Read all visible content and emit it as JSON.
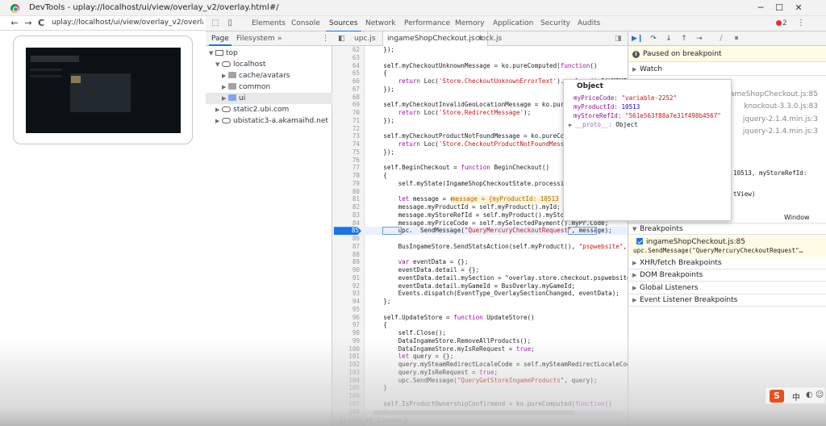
{
  "window": {
    "title": "DevTools - uplay://localhost/ui/view/overlay_v2/overlay.html#/",
    "controls": {
      "minimize": "─",
      "maximize": "☐",
      "close": "✕"
    }
  },
  "browser": {
    "back": "←",
    "forward": "→",
    "reload": "C",
    "url": "uplay://localhost/ui/view/overlay_v2/overlay.html#"
  },
  "devtools": {
    "tabs": [
      "Elements",
      "Console",
      "Sources",
      "Network",
      "Performance",
      "Memory",
      "Application",
      "Security",
      "Audits"
    ],
    "active_tab": "Sources",
    "error_count": "2",
    "accent": "#1a73e8"
  },
  "navigator": {
    "tabs": [
      "Page",
      "Filesystem"
    ],
    "more": "»",
    "tree": [
      {
        "label": "top",
        "icon": "frame-icon"
      },
      {
        "label": "localhost",
        "icon": "cloud-icon"
      },
      {
        "label": "cache/avatars",
        "icon": "folder-icon"
      },
      {
        "label": "common",
        "icon": "folder-icon"
      },
      {
        "label": "ui",
        "icon": "folder-icon"
      },
      {
        "label": "static2.ubi.com",
        "icon": "cloud-icon"
      },
      {
        "label": "ubistatic3-a.akamaihd.net",
        "icon": "cloud-icon"
      }
    ]
  },
  "editor": {
    "tabs": [
      "upc.js",
      "ingameShopCheckout.js",
      "clock.js"
    ],
    "active_tab": "ingameShopCheckout.js",
    "close_glyph": "×",
    "paused_line": "85",
    "inline_value": "message = {myProductId: 10513",
    "lines": [
      {
        "n": "62",
        "t": "    });"
      },
      {
        "n": "63",
        "t": ""
      },
      {
        "n": "64",
        "t": "    self.myCheckoutUnknownMessage = ko.pureComputed(function()"
      },
      {
        "n": "65",
        "t": "    {"
      },
      {
        "n": "66",
        "t": "        return Loc('Store.CheckoutUnknownErrorText').replace('_PAYMENT"
      },
      {
        "n": "67",
        "t": "    });"
      },
      {
        "n": "68",
        "t": ""
      },
      {
        "n": "69",
        "t": "    self.myCheckoutInvalidGeoLocationMessage = ko.pureCom"
      },
      {
        "n": "70",
        "t": "        return Loc('Store.RedirectMessage');"
      },
      {
        "n": "71",
        "t": "    });"
      },
      {
        "n": "72",
        "t": ""
      },
      {
        "n": "73",
        "t": "    self.myCheckoutProductNotFoundMessage = ko.pureComput"
      },
      {
        "n": "74",
        "t": "        return Loc('Store.CheckoutProductNotFoundMessage'"
      },
      {
        "n": "75",
        "t": "    });"
      },
      {
        "n": "76",
        "t": ""
      },
      {
        "n": "77",
        "t": "    self.BeginCheckout = function BeginCheckout()"
      },
      {
        "n": "78",
        "t": "    {"
      },
      {
        "n": "79",
        "t": "        self.myState(IngameShopCheckoutState.processing);"
      },
      {
        "n": "80",
        "t": ""
      },
      {
        "n": "81",
        "t": "        let message = {};"
      },
      {
        "n": "82",
        "t": "        message.myProductId = self.myProduct().myId;"
      },
      {
        "n": "83",
        "t": "        message.myStoreRefId = self.myProduct().myStoreRe"
      },
      {
        "n": "84",
        "t": "        message.myPriceCode = self.mySelectedPayment().myPr.Code;"
      },
      {
        "n": "85",
        "t": "        upc.  SendMessage(\"QueryMercuryCheckoutRequest\", message);"
      },
      {
        "n": "86",
        "t": ""
      },
      {
        "n": "87",
        "t": "        BusIngameStore.SendStatsAction(self.myProduct(), \"pspwebsite\","
      },
      {
        "n": "88",
        "t": ""
      },
      {
        "n": "89",
        "t": "        var eventData = {};"
      },
      {
        "n": "90",
        "t": "        eventData.detail = {};"
      },
      {
        "n": "91",
        "t": "        eventData.detail.mySection = \"overlay.store.checkout.pspwebsite"
      },
      {
        "n": "92",
        "t": "        eventData.detail.myGameId = BusOverlay.myGameId;"
      },
      {
        "n": "93",
        "t": "        Events.dispatch(EventType_OverlaySectionChanged, eventData);"
      },
      {
        "n": "94",
        "t": "    };"
      },
      {
        "n": "95",
        "t": ""
      },
      {
        "n": "96",
        "t": "    self.UpdateStore = function UpdateStore()"
      },
      {
        "n": "97",
        "t": "    {"
      },
      {
        "n": "98",
        "t": "        self.Close();"
      },
      {
        "n": "99",
        "t": "        DataIngameStore.RemoveAllProducts();"
      },
      {
        "n": "100",
        "t": "        DataIngameStore.myIsReRequest = true;"
      },
      {
        "n": "101",
        "t": "        let query = {};"
      },
      {
        "n": "102",
        "t": "        query.mySteamRedirectLocaleCode = self.mySteamRedirectLocaleCod"
      },
      {
        "n": "103",
        "t": "        query.myIsReRequest = true;"
      },
      {
        "n": "104",
        "t": "        upc.SendMessage(\"QueryGetStoreIngameProducts\", query);"
      },
      {
        "n": "105",
        "t": "    }"
      },
      {
        "n": "106",
        "t": ""
      },
      {
        "n": "107",
        "t": "    self.IsProductOwnershipConfirmend = ko.pureComputed(function()"
      },
      {
        "n": "108",
        "t": "    {"
      }
    ],
    "status": "{}   Line 85, Column 2"
  },
  "popover": {
    "title": "Object",
    "rows": [
      {
        "key": "myPriceCode:",
        "value": "\"variable-2252\"",
        "kind": "string"
      },
      {
        "key": "myProductId:",
        "value": "10513",
        "kind": "number"
      },
      {
        "key": "myStoreRefId:",
        "value": "\"561e563f88a7e31f498b4567\"",
        "kind": "string"
      },
      {
        "key": "__proto__:",
        "value": "Object",
        "kind": "object"
      }
    ]
  },
  "debugger": {
    "paused_text": "Paused on breakpoint",
    "watch": "Watch",
    "call_stack": [
      {
        "label": "ameShopCheckout.js:85"
      },
      {
        "label": "knockout-3.3.0.js:83"
      },
      {
        "label": "jquery-2.1.4.min.js:3"
      },
      {
        "label": "jquery-2.1.4.min.js:3"
      }
    ],
    "scope_fragments": [
      "10513, myStoreRefId:",
      "tView)",
      "Window"
    ],
    "breakpoints_header": "Breakpoints",
    "breakpoint": {
      "file": "ingameShopCheckout.js:85",
      "code": "upc.SendMessage(\"QueryMercuryCheckoutRequest\"…"
    },
    "sections": [
      "XHR/fetch Breakpoints",
      "DOM Breakpoints",
      "Global Listeners",
      "Event Listener Breakpoints"
    ]
  },
  "ime": {
    "logo": "S",
    "lang": "中"
  }
}
